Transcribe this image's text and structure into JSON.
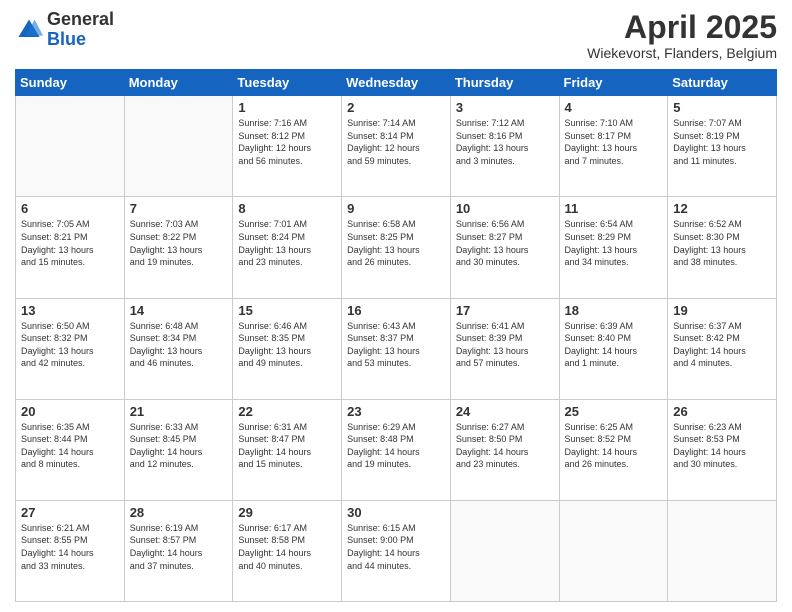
{
  "logo": {
    "general": "General",
    "blue": "Blue"
  },
  "header": {
    "title": "April 2025",
    "subtitle": "Wiekevorst, Flanders, Belgium"
  },
  "weekdays": [
    "Sunday",
    "Monday",
    "Tuesday",
    "Wednesday",
    "Thursday",
    "Friday",
    "Saturday"
  ],
  "weeks": [
    [
      {
        "day": "",
        "detail": ""
      },
      {
        "day": "",
        "detail": ""
      },
      {
        "day": "1",
        "detail": "Sunrise: 7:16 AM\nSunset: 8:12 PM\nDaylight: 12 hours\nand 56 minutes."
      },
      {
        "day": "2",
        "detail": "Sunrise: 7:14 AM\nSunset: 8:14 PM\nDaylight: 12 hours\nand 59 minutes."
      },
      {
        "day": "3",
        "detail": "Sunrise: 7:12 AM\nSunset: 8:16 PM\nDaylight: 13 hours\nand 3 minutes."
      },
      {
        "day": "4",
        "detail": "Sunrise: 7:10 AM\nSunset: 8:17 PM\nDaylight: 13 hours\nand 7 minutes."
      },
      {
        "day": "5",
        "detail": "Sunrise: 7:07 AM\nSunset: 8:19 PM\nDaylight: 13 hours\nand 11 minutes."
      }
    ],
    [
      {
        "day": "6",
        "detail": "Sunrise: 7:05 AM\nSunset: 8:21 PM\nDaylight: 13 hours\nand 15 minutes."
      },
      {
        "day": "7",
        "detail": "Sunrise: 7:03 AM\nSunset: 8:22 PM\nDaylight: 13 hours\nand 19 minutes."
      },
      {
        "day": "8",
        "detail": "Sunrise: 7:01 AM\nSunset: 8:24 PM\nDaylight: 13 hours\nand 23 minutes."
      },
      {
        "day": "9",
        "detail": "Sunrise: 6:58 AM\nSunset: 8:25 PM\nDaylight: 13 hours\nand 26 minutes."
      },
      {
        "day": "10",
        "detail": "Sunrise: 6:56 AM\nSunset: 8:27 PM\nDaylight: 13 hours\nand 30 minutes."
      },
      {
        "day": "11",
        "detail": "Sunrise: 6:54 AM\nSunset: 8:29 PM\nDaylight: 13 hours\nand 34 minutes."
      },
      {
        "day": "12",
        "detail": "Sunrise: 6:52 AM\nSunset: 8:30 PM\nDaylight: 13 hours\nand 38 minutes."
      }
    ],
    [
      {
        "day": "13",
        "detail": "Sunrise: 6:50 AM\nSunset: 8:32 PM\nDaylight: 13 hours\nand 42 minutes."
      },
      {
        "day": "14",
        "detail": "Sunrise: 6:48 AM\nSunset: 8:34 PM\nDaylight: 13 hours\nand 46 minutes."
      },
      {
        "day": "15",
        "detail": "Sunrise: 6:46 AM\nSunset: 8:35 PM\nDaylight: 13 hours\nand 49 minutes."
      },
      {
        "day": "16",
        "detail": "Sunrise: 6:43 AM\nSunset: 8:37 PM\nDaylight: 13 hours\nand 53 minutes."
      },
      {
        "day": "17",
        "detail": "Sunrise: 6:41 AM\nSunset: 8:39 PM\nDaylight: 13 hours\nand 57 minutes."
      },
      {
        "day": "18",
        "detail": "Sunrise: 6:39 AM\nSunset: 8:40 PM\nDaylight: 14 hours\nand 1 minute."
      },
      {
        "day": "19",
        "detail": "Sunrise: 6:37 AM\nSunset: 8:42 PM\nDaylight: 14 hours\nand 4 minutes."
      }
    ],
    [
      {
        "day": "20",
        "detail": "Sunrise: 6:35 AM\nSunset: 8:44 PM\nDaylight: 14 hours\nand 8 minutes."
      },
      {
        "day": "21",
        "detail": "Sunrise: 6:33 AM\nSunset: 8:45 PM\nDaylight: 14 hours\nand 12 minutes."
      },
      {
        "day": "22",
        "detail": "Sunrise: 6:31 AM\nSunset: 8:47 PM\nDaylight: 14 hours\nand 15 minutes."
      },
      {
        "day": "23",
        "detail": "Sunrise: 6:29 AM\nSunset: 8:48 PM\nDaylight: 14 hours\nand 19 minutes."
      },
      {
        "day": "24",
        "detail": "Sunrise: 6:27 AM\nSunset: 8:50 PM\nDaylight: 14 hours\nand 23 minutes."
      },
      {
        "day": "25",
        "detail": "Sunrise: 6:25 AM\nSunset: 8:52 PM\nDaylight: 14 hours\nand 26 minutes."
      },
      {
        "day": "26",
        "detail": "Sunrise: 6:23 AM\nSunset: 8:53 PM\nDaylight: 14 hours\nand 30 minutes."
      }
    ],
    [
      {
        "day": "27",
        "detail": "Sunrise: 6:21 AM\nSunset: 8:55 PM\nDaylight: 14 hours\nand 33 minutes."
      },
      {
        "day": "28",
        "detail": "Sunrise: 6:19 AM\nSunset: 8:57 PM\nDaylight: 14 hours\nand 37 minutes."
      },
      {
        "day": "29",
        "detail": "Sunrise: 6:17 AM\nSunset: 8:58 PM\nDaylight: 14 hours\nand 40 minutes."
      },
      {
        "day": "30",
        "detail": "Sunrise: 6:15 AM\nSunset: 9:00 PM\nDaylight: 14 hours\nand 44 minutes."
      },
      {
        "day": "",
        "detail": ""
      },
      {
        "day": "",
        "detail": ""
      },
      {
        "day": "",
        "detail": ""
      }
    ]
  ]
}
